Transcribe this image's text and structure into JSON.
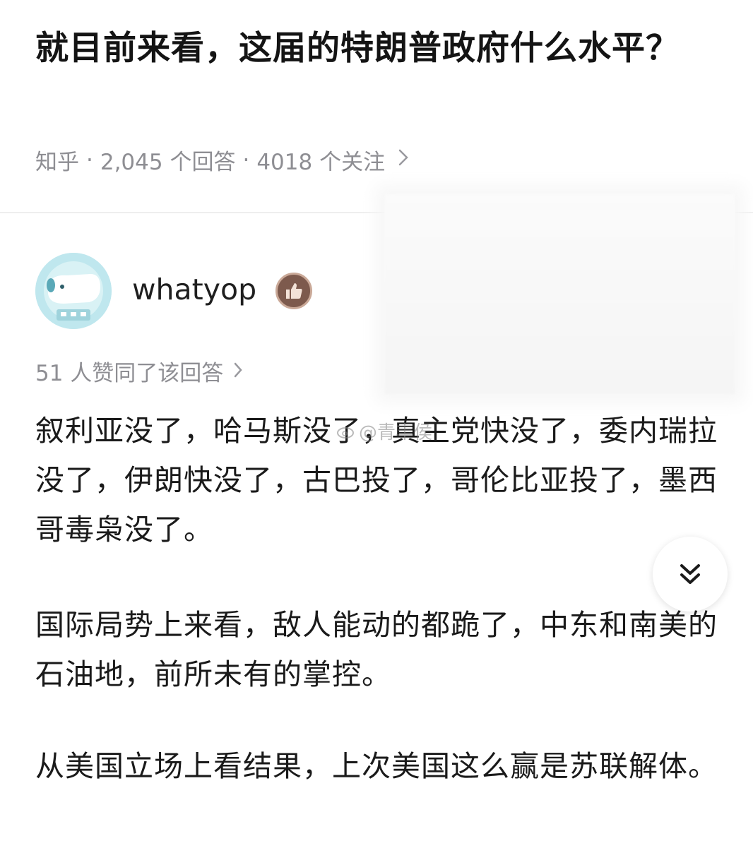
{
  "question": {
    "title": "就目前来看，这届的特朗普政府什么水平？",
    "source": "知乎",
    "sep": "·",
    "answers": "2,045 个回答",
    "followers": "4018 个关注"
  },
  "answer": {
    "author": "whatyop",
    "upvote_text": "51 人赞同了该回答",
    "paragraphs": [
      "叙利亚没了，哈马斯没了，真主党快没了，委内瑞拉没了，伊朗快没了，古巴投了，哥伦比亚投了，墨西哥毒枭没了。",
      "国际局势上来看，敌人能动的都跪了，中东和南美的石油地，前所未有的掌控。",
      "从美国立场上看结果，上次美国这么赢是苏联解体。"
    ]
  },
  "watermark": {
    "text": "@青丰侯"
  },
  "icons": {
    "meta_chevron": "chevron-right-icon",
    "upvote_chevron": "chevron-right-icon",
    "expand": "double-chevron-down-icon",
    "badge": "thumbs-up-badge-icon"
  },
  "colors": {
    "meta_gray": "#8e8e93",
    "badge_brown": "#7d5a4d",
    "avatar_teal": "#bfe7ee"
  }
}
